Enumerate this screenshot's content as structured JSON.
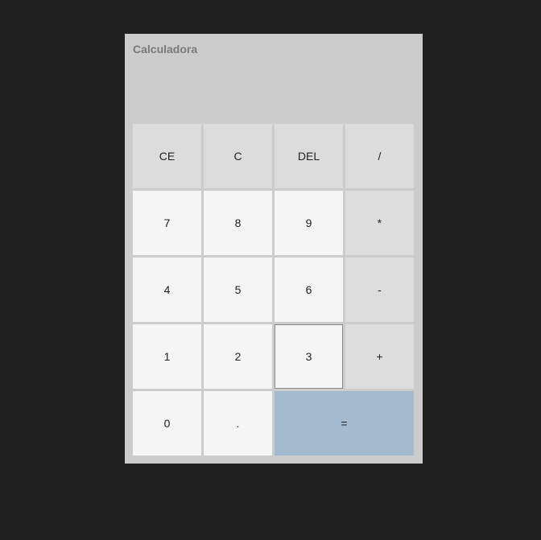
{
  "app": {
    "title": "Calculadora",
    "display_value": ""
  },
  "colors": {
    "equals_button": "#a4bbcf",
    "background": "#202020",
    "panel": "#cccccc"
  },
  "buttons": {
    "ce": "CE",
    "c": "C",
    "del": "DEL",
    "divide": "/",
    "seven": "7",
    "eight": "8",
    "nine": "9",
    "multiply": "*",
    "four": "4",
    "five": "5",
    "six": "6",
    "subtract": "-",
    "one": "1",
    "two": "2",
    "three": "3",
    "add": "+",
    "zero": "0",
    "decimal": ".",
    "equals": "="
  }
}
